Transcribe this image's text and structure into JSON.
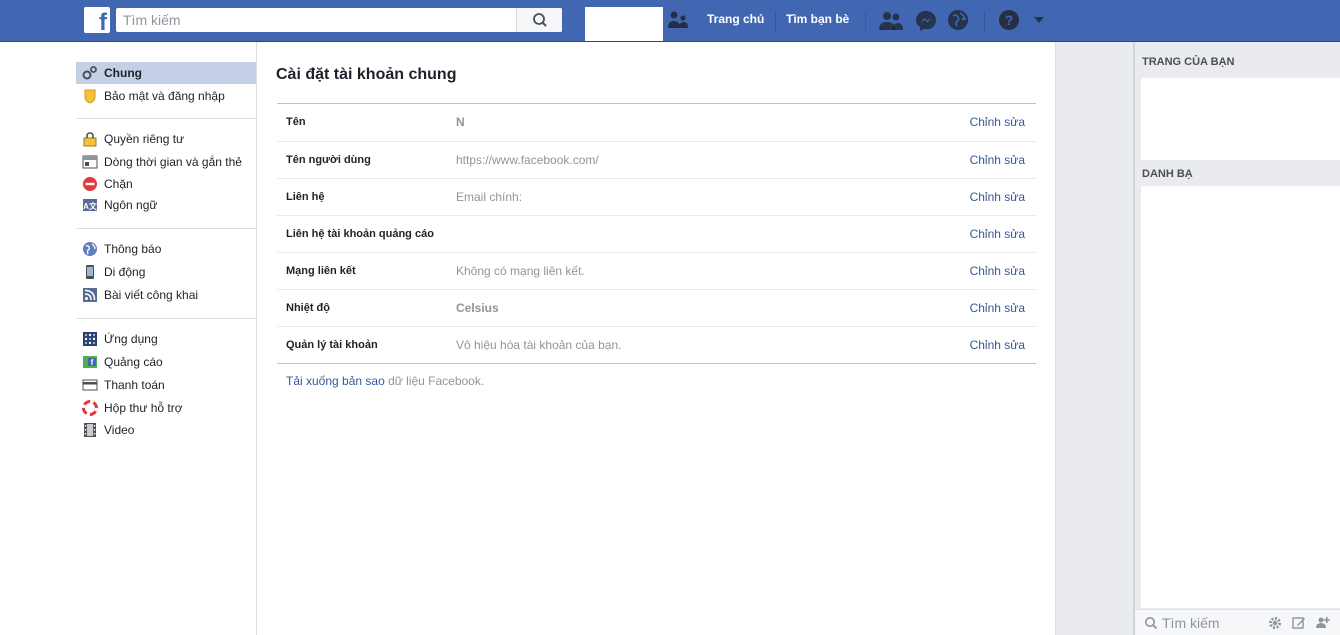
{
  "topbar": {
    "logo": "f",
    "search_placeholder": "Tìm kiếm",
    "home_label": "Trang chủ",
    "find_friends_label": "Tìm bạn bè",
    "icons": [
      "friends-icon",
      "messenger-icon",
      "globe-icon",
      "help-icon",
      "caret-down-icon"
    ]
  },
  "leftnav": {
    "groups": [
      [
        {
          "label": "Chung",
          "icon": "gears-icon",
          "active": true
        },
        {
          "label": "Bảo mật và đăng nhập",
          "icon": "shield-icon"
        }
      ],
      [
        {
          "label": "Quyền riêng tư",
          "icon": "lock-icon"
        },
        {
          "label": "Dòng thời gian và gắn thẻ",
          "icon": "timeline-icon"
        },
        {
          "label": "Chặn",
          "icon": "block-icon"
        },
        {
          "label": "Ngôn ngữ",
          "icon": "language-icon"
        }
      ],
      [
        {
          "label": "Thông báo",
          "icon": "globe-icon"
        },
        {
          "label": "Di động",
          "icon": "mobile-icon"
        },
        {
          "label": "Bài viết công khai",
          "icon": "rss-icon"
        }
      ],
      [
        {
          "label": "Ứng dụng",
          "icon": "apps-icon"
        },
        {
          "label": "Quảng cáo",
          "icon": "ads-icon"
        },
        {
          "label": "Thanh toán",
          "icon": "card-icon"
        },
        {
          "label": "Hộp thư hỗ trợ",
          "icon": "lifebuoy-icon"
        },
        {
          "label": "Video",
          "icon": "film-icon"
        }
      ]
    ]
  },
  "main": {
    "title": "Cài đặt tài khoản chung",
    "rows": [
      {
        "key": "Tên",
        "value": "N",
        "value_bold": true,
        "edit": "Chỉnh sửa"
      },
      {
        "key": "Tên người dùng",
        "value": "https://www.facebook.com/",
        "edit": "Chỉnh sửa"
      },
      {
        "key": "Liên hệ",
        "value": "Email chính:",
        "edit": "Chỉnh sửa"
      },
      {
        "key": "Liên hệ tài khoản quảng cáo",
        "value": "",
        "edit": "Chỉnh sửa"
      },
      {
        "key": "Mạng liên kết",
        "value": "Không có mạng liên kết.",
        "edit": "Chỉnh sửa"
      },
      {
        "key": "Nhiệt độ",
        "value": "Celsius",
        "value_bold": true,
        "edit": "Chỉnh sửa"
      },
      {
        "key": "Quản lý tài khoản",
        "value": "Vô hiệu hóa tài khoản của bạn.",
        "edit": "Chỉnh sửa"
      }
    ],
    "download_link": "Tải xuống bản sao",
    "download_rest": " dữ liệu Facebook."
  },
  "right": {
    "pages_heading": "TRANG CỦA BẠN",
    "contacts_heading": "DANH BẠ",
    "chat_search_placeholder": "Tìm kiếm"
  },
  "colors": {
    "brand": "#4267b2",
    "link": "#365899",
    "active_nav": "#c5d0e6"
  }
}
